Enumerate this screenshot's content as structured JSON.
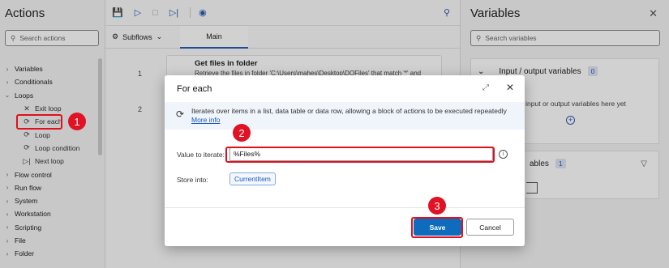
{
  "actions_panel": {
    "title": "Actions",
    "search_placeholder": "Search actions",
    "tree": [
      {
        "label": "Variables",
        "level": 1,
        "icon": "chevron-right-icon"
      },
      {
        "label": "Conditionals",
        "level": 1,
        "icon": "chevron-right-icon"
      },
      {
        "label": "Loops",
        "level": 1,
        "icon": "chevron-down-icon"
      },
      {
        "label": "Exit loop",
        "level": 2,
        "icon": "exit-loop-icon"
      },
      {
        "label": "For each",
        "level": 2,
        "icon": "loop-icon"
      },
      {
        "label": "Loop",
        "level": 2,
        "icon": "loop-icon"
      },
      {
        "label": "Loop condition",
        "level": 2,
        "icon": "loop-icon"
      },
      {
        "label": "Next loop",
        "level": 2,
        "icon": "next-loop-icon"
      },
      {
        "label": "Flow control",
        "level": 1,
        "icon": "chevron-right-icon"
      },
      {
        "label": "Run flow",
        "level": 1,
        "icon": "chevron-right-icon"
      },
      {
        "label": "System",
        "level": 1,
        "icon": "chevron-right-icon"
      },
      {
        "label": "Workstation",
        "level": 1,
        "icon": "chevron-right-icon"
      },
      {
        "label": "Scripting",
        "level": 1,
        "icon": "chevron-right-icon"
      },
      {
        "label": "File",
        "level": 1,
        "icon": "chevron-right-icon"
      },
      {
        "label": "Folder",
        "level": 1,
        "icon": "chevron-right-icon"
      }
    ]
  },
  "designer": {
    "subflows_label": "Subflows",
    "main_tab": "Main",
    "steps": [
      {
        "number": "1",
        "title": "Get files in folder",
        "description": "Retrieve the files in folder 'C:\\Users\\mahes\\Desktop\\DOFiles' that match '*' and"
      },
      {
        "number": "2",
        "title": "",
        "description": ""
      }
    ]
  },
  "variables_panel": {
    "title": "Variables",
    "search_placeholder": "Search variables",
    "io_section": {
      "title": "Input / output variables",
      "count": "0",
      "empty_text": "n't any input or output variables here yet"
    },
    "flow_section": {
      "title": "ables",
      "count": "1"
    }
  },
  "dialog": {
    "title": "For each",
    "info_text": "Iterates over items in a list, data table or data row, allowing a block of actions to be executed repeatedly",
    "more_info": "More info",
    "value_label": "Value to iterate:",
    "value": "%Files%",
    "store_label": "Store into:",
    "store_value": "CurrentItem",
    "save_label": "Save",
    "cancel_label": "Cancel"
  },
  "callouts": {
    "one": "1",
    "two": "2",
    "three": "3"
  },
  "colors": {
    "highlight": "#e0101e",
    "accent": "#2b5cb8",
    "primary_button": "#0f6cbd"
  }
}
